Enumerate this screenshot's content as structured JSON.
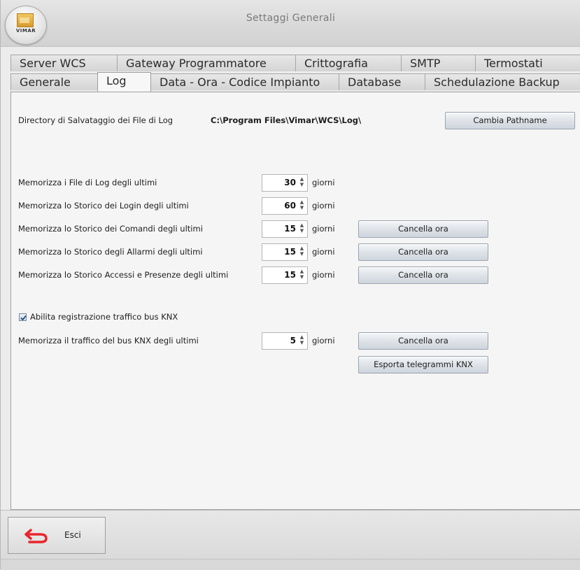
{
  "window": {
    "title": "Settaggi Generali",
    "logo_text": "VIMAR"
  },
  "tabs": {
    "row1": [
      "Server WCS",
      "Gateway Programmatore",
      "Crittografia",
      "SMTP",
      "Termostati"
    ],
    "row2": [
      "Generale",
      "Log",
      "Data - Ora - Codice Impianto",
      "Database",
      "Schedulazione Backup"
    ],
    "selected": "Log"
  },
  "log": {
    "dir_label": "Directory di Salvataggio dei File di Log",
    "dir_value": "C:\\Program Files\\Vimar\\WCS\\Log\\",
    "change_path_button": "Cambia Pathname",
    "unit": "giorni",
    "rows": [
      {
        "label": "Memorizza i File di Log degli ultimi",
        "value": "30"
      },
      {
        "label": "Memorizza lo Storico dei Login degli ultimi",
        "value": "60"
      },
      {
        "label": "Memorizza lo Storico dei Comandi degli ultimi",
        "value": "15",
        "button": "Cancella ora"
      },
      {
        "label": "Memorizza lo Storico degli Allarmi degli ultimi",
        "value": "15",
        "button": "Cancella ora"
      },
      {
        "label": "Memorizza lo Storico Accessi e Presenze degli ultimi",
        "value": "15",
        "button": "Cancella ora"
      }
    ],
    "knx_checkbox_label": "Abilita registrazione traffico bus KNX",
    "knx_checked": true,
    "knx_row": {
      "label": "Memorizza il traffico del bus KNX degli ultimi",
      "value": "5",
      "button": "Cancella ora"
    },
    "export_button": "Esporta telegrammi KNX"
  },
  "footer": {
    "exit_label": "Esci"
  },
  "colors": {
    "exit_arrow": "#e8262b"
  }
}
